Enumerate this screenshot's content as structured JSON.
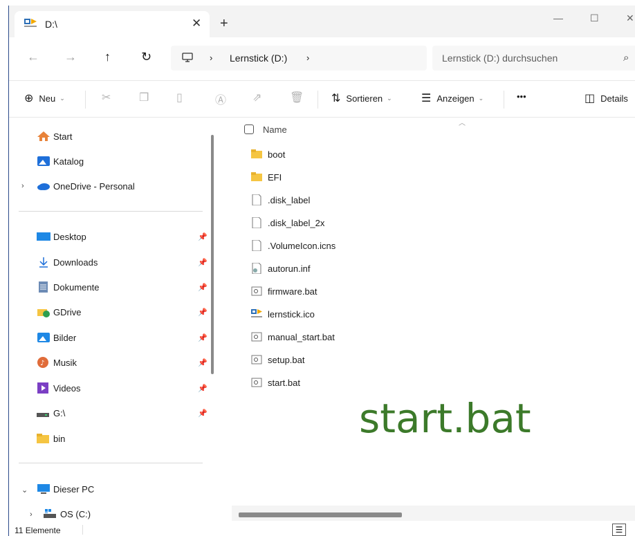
{
  "tab": {
    "title": "D:\\",
    "close": "✕",
    "new": "+"
  },
  "window": {
    "minimize": "—",
    "maximize": "☐",
    "close": "✕"
  },
  "nav": {
    "back": "←",
    "forward": "→",
    "up": "↑",
    "refresh": "↻"
  },
  "address": {
    "chevron": "›",
    "location": "Lernstick (D:)"
  },
  "search": {
    "placeholder": "Lernstick (D:) durchsuchen"
  },
  "toolbar": {
    "new_label": "Neu",
    "sort_label": "Sortieren",
    "view_label": "Anzeigen",
    "more_label": "•••",
    "details_label": "Details"
  },
  "sidebar": {
    "top": [
      {
        "label": "Start",
        "icon": "home-icon"
      },
      {
        "label": "Katalog",
        "icon": "gallery-icon"
      },
      {
        "label": "OneDrive - Personal",
        "icon": "cloud-icon"
      }
    ],
    "quick": [
      {
        "label": "Desktop",
        "icon": "desktop-icon",
        "pinned": true
      },
      {
        "label": "Downloads",
        "icon": "download-icon",
        "pinned": true
      },
      {
        "label": "Dokumente",
        "icon": "document-icon",
        "pinned": true
      },
      {
        "label": "GDrive",
        "icon": "gdrive-icon",
        "pinned": true
      },
      {
        "label": "Bilder",
        "icon": "pictures-icon",
        "pinned": true
      },
      {
        "label": "Musik",
        "icon": "music-icon",
        "pinned": true
      },
      {
        "label": "Videos",
        "icon": "videos-icon",
        "pinned": true
      },
      {
        "label": "G:\\",
        "icon": "drive-icon",
        "pinned": true
      },
      {
        "label": "bin",
        "icon": "folder-icon",
        "pinned": false
      }
    ],
    "bottom": [
      {
        "label": "Dieser PC",
        "icon": "pc-icon"
      },
      {
        "label": "OS (C:)",
        "icon": "os-drive-icon"
      }
    ]
  },
  "columns": {
    "name": "Name"
  },
  "files": [
    {
      "name": "boot",
      "type": "folder"
    },
    {
      "name": "EFI",
      "type": "folder"
    },
    {
      "name": ".disk_label",
      "type": "file"
    },
    {
      "name": ".disk_label_2x",
      "type": "file"
    },
    {
      "name": ".VolumeIcon.icns",
      "type": "file"
    },
    {
      "name": "autorun.inf",
      "type": "inf"
    },
    {
      "name": "firmware.bat",
      "type": "bat"
    },
    {
      "name": "lernstick.ico",
      "type": "ico"
    },
    {
      "name": "manual_start.bat",
      "type": "bat"
    },
    {
      "name": "setup.bat",
      "type": "bat"
    },
    {
      "name": "start.bat",
      "type": "bat"
    }
  ],
  "overlay_label": "start.bat",
  "status": {
    "count": "11 Elemente"
  },
  "colors": {
    "accent": "#3c7a2a",
    "folder": "#f5c542",
    "frame": "#2b4a8a"
  }
}
